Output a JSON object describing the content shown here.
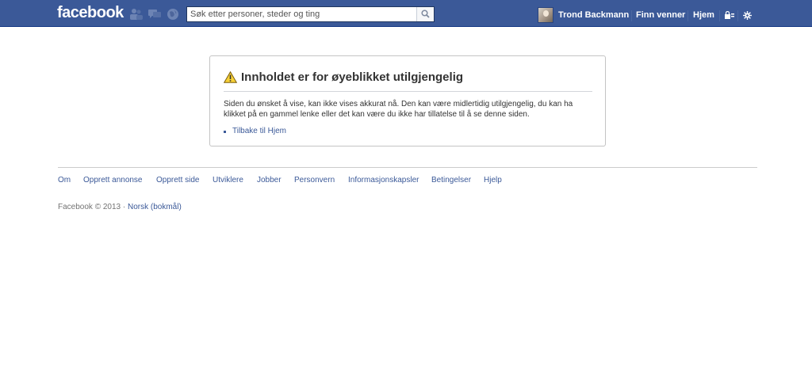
{
  "header": {
    "logo": "facebook",
    "search_placeholder": "Søk etter personer, steder og ting",
    "user_name": "Trond Backmann",
    "nav": {
      "find_friends": "Finn venner",
      "home": "Hjem"
    },
    "colors": {
      "bar": "#3b5998",
      "bar_border": "#133783"
    },
    "icons": [
      "friend-requests-icon",
      "messages-icon",
      "notifications-icon",
      "search-icon",
      "privacy-icon",
      "settings-icon"
    ]
  },
  "error": {
    "title": "Innholdet er for øyeblikket utilgjengelig",
    "body": "Siden du ønsket å vise, kan ikke vises akkurat nå. Den kan være midlertidig utilgjengelig, du kan ha klikket på en gammel lenke eller det kan være du ikke har tillatelse til å se denne siden.",
    "link": "Tilbake til Hjem",
    "icon": "warning-icon"
  },
  "footer": {
    "links": [
      "Om",
      "Opprett annonse",
      "Opprett side",
      "Utviklere",
      "Jobber",
      "Personvern",
      "Informasjonskapsler",
      "Betingelser",
      "Hjelp"
    ],
    "copyright": "Facebook © 2013 ·",
    "language": "Norsk (bokmål)"
  }
}
